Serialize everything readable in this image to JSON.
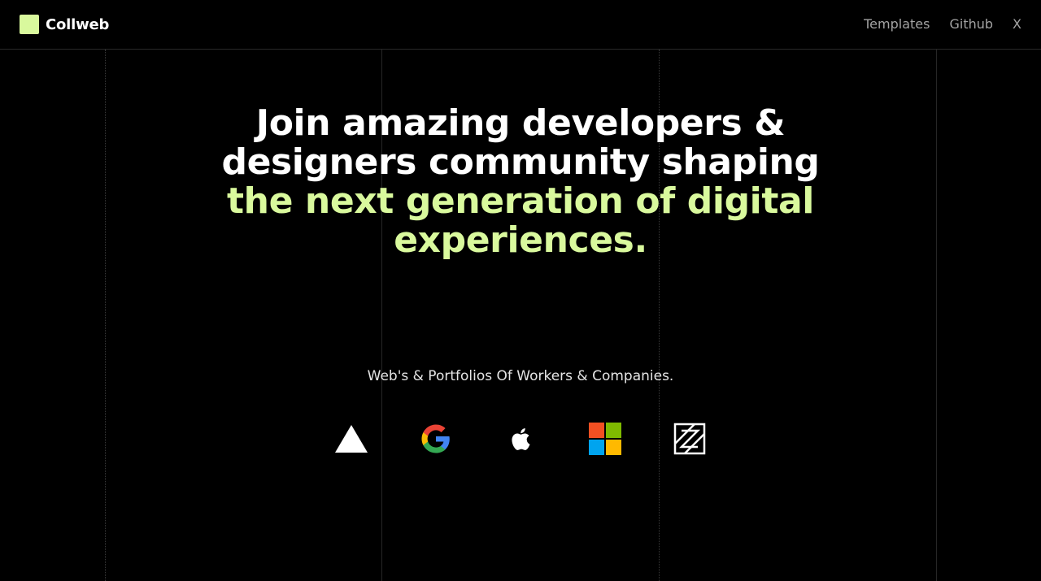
{
  "brand": {
    "name": "Collweb",
    "accent_color": "#d9f99d",
    "logo_icon": "square-logo-icon"
  },
  "nav": {
    "items": [
      {
        "label": "Templates"
      },
      {
        "label": "Github"
      },
      {
        "label": "X"
      }
    ]
  },
  "hero": {
    "line_white_1": "Join amazing developers &",
    "line_white_2": "designers community shaping",
    "line_green_1": "the next generation of digital",
    "line_green_2": "experiences."
  },
  "showcase": {
    "subtitle": "Web's & Portfolios Of Workers & Companies.",
    "logos": [
      {
        "icon": "vercel-triangle-icon"
      },
      {
        "icon": "google-g-icon"
      },
      {
        "icon": "apple-icon"
      },
      {
        "icon": "microsoft-icon"
      },
      {
        "icon": "zeplin-z-icon"
      }
    ]
  },
  "colors": {
    "background": "#000000",
    "text": "#ffffff",
    "muted_text": "#a3a3a3",
    "accent": "#d9f99d"
  }
}
